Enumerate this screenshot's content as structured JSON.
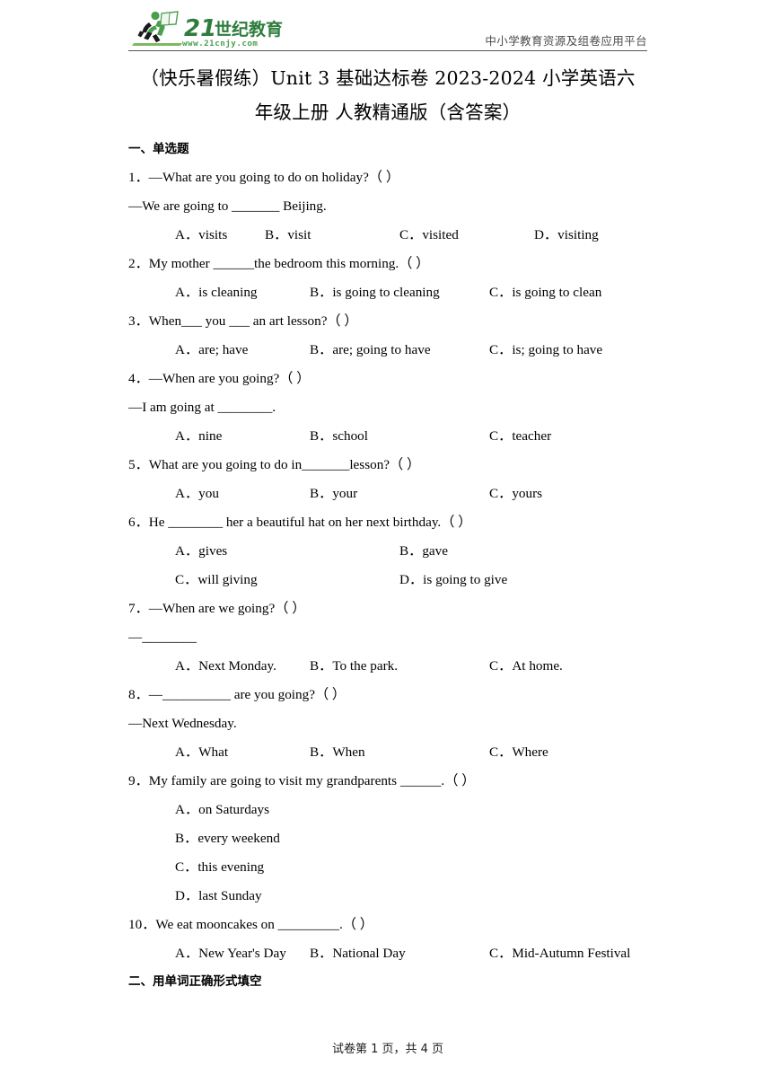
{
  "header": {
    "logo_alt": "21shiji-jiaoyu-logo",
    "logo_text_main": "21世纪教育",
    "logo_text_url": "www.21cnjy.com",
    "tagline": "中小学教育资源及组卷应用平台",
    "logo_green": "#3f9a4e",
    "logo_dark_green": "#2e7d3c",
    "rule_color": "#555555"
  },
  "title": {
    "line1": "（快乐暑假练）Unit 3 基础达标卷 2023-2024 小学英语六",
    "line2": "年级上册  人教精通版（含答案）"
  },
  "sections": [
    {
      "id": "section-1",
      "label": "一、单选题"
    },
    {
      "id": "section-2",
      "label": "二、用单词正确形式填空"
    }
  ],
  "questions": [
    {
      "num": "1．",
      "stem": "—What are you going to do on holiday?（  ）",
      "stem_cont": "—We are going to _______ Beijing.",
      "columns": 4,
      "options": [
        {
          "label": "A．",
          "text": "visits"
        },
        {
          "label": "B．",
          "text": "visit"
        },
        {
          "label": "C．",
          "text": "visited"
        },
        {
          "label": "D．",
          "text": "visiting"
        }
      ]
    },
    {
      "num": "2．",
      "stem": "My mother ______the bedroom this morning.（  ）",
      "stem_cont": "",
      "columns": 3,
      "options": [
        {
          "label": "A．",
          "text": "is cleaning"
        },
        {
          "label": "B．",
          "text": "is going to cleaning"
        },
        {
          "label": "C．",
          "text": "is going to clean"
        }
      ]
    },
    {
      "num": "3．",
      "stem": "When___ you ___ an art lesson?（  ）",
      "stem_cont": "",
      "columns": 3,
      "options": [
        {
          "label": "A．",
          "text": "are; have"
        },
        {
          "label": "B．",
          "text": "are; going to have"
        },
        {
          "label": "C．",
          "text": "is; going to have"
        }
      ]
    },
    {
      "num": "4．",
      "stem": "—When are you going?（  ）",
      "stem_cont": "—I am going at ________.",
      "columns": 3,
      "options": [
        {
          "label": "A．",
          "text": "nine"
        },
        {
          "label": "B．",
          "text": "school"
        },
        {
          "label": "C．",
          "text": "teacher"
        }
      ]
    },
    {
      "num": "5．",
      "stem": "What are you going to do in_______lesson?（  ）",
      "stem_cont": "",
      "columns": 3,
      "options": [
        {
          "label": "A．",
          "text": "you"
        },
        {
          "label": "B．",
          "text": "your"
        },
        {
          "label": "C．",
          "text": "yours"
        }
      ]
    },
    {
      "num": "6．",
      "stem": "He ________ her a beautiful hat on her next birthday.（  ）",
      "stem_cont": "",
      "columns": 2,
      "options": [
        {
          "label": "A．",
          "text": "gives"
        },
        {
          "label": "B．",
          "text": "gave"
        },
        {
          "label": "C．",
          "text": "will giving"
        },
        {
          "label": "D．",
          "text": "is going to give"
        }
      ]
    },
    {
      "num": "7．",
      "stem": "—When are we going?（ ）",
      "stem_cont": "—________",
      "columns": 3,
      "options": [
        {
          "label": "A．",
          "text": "Next Monday."
        },
        {
          "label": "B．",
          "text": "To the park."
        },
        {
          "label": "C．",
          "text": "At home."
        }
      ]
    },
    {
      "num": "8．",
      "stem": "—__________ are you going?（ ）",
      "stem_cont": "—Next Wednesday.",
      "columns": 3,
      "options": [
        {
          "label": "A．",
          "text": "What"
        },
        {
          "label": "B．",
          "text": "When"
        },
        {
          "label": "C．",
          "text": "Where"
        }
      ]
    },
    {
      "num": "9．",
      "stem": "My family are going to visit my grandparents ______.（ ）",
      "stem_cont": "",
      "columns": 1,
      "options": [
        {
          "label": "A．",
          "text": "on Saturdays"
        },
        {
          "label": "B．",
          "text": "every weekend"
        },
        {
          "label": "C．",
          "text": "this evening"
        },
        {
          "label": "D．",
          "text": "last Sunday"
        }
      ]
    },
    {
      "num": "10．",
      "stem": "We eat mooncakes on _________.（  ）",
      "stem_cont": "",
      "columns": 3,
      "options": [
        {
          "label": "A．",
          "text": "New Year's Day"
        },
        {
          "label": "B．",
          "text": "National Day"
        },
        {
          "label": "C．",
          "text": "Mid-Autumn Festival"
        }
      ]
    }
  ],
  "footer": {
    "text": "试卷第 1 页，共 4 页",
    "page_current": "1",
    "page_total": "4"
  }
}
